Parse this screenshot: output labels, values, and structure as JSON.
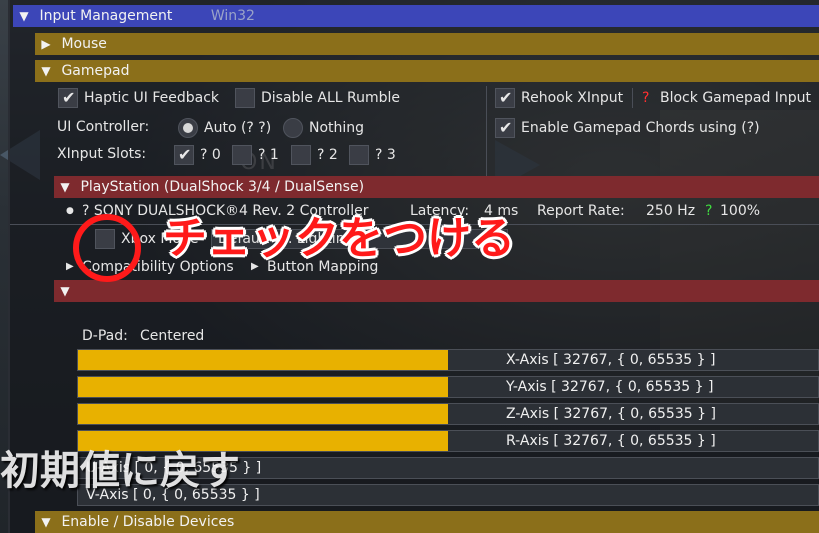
{
  "colors": {
    "section_blue": "#3c46b8",
    "section_gold": "#8b6f1a",
    "section_red": "#7e2a2e",
    "axis_fill": "#e8b100",
    "annotation": "#ff1a1a",
    "green": "#3fdc3f",
    "red": "#ff3030"
  },
  "header": {
    "title": "Input Management",
    "platform": "Win32"
  },
  "sections": {
    "mouse": "Mouse",
    "gamepad": "Gamepad",
    "enable_devices": "Enable / Disable Devices"
  },
  "gamepad": {
    "haptic": {
      "label": "Haptic UI Feedback",
      "checked": true
    },
    "disable_rumble": {
      "label": "Disable ALL Rumble",
      "checked": false
    },
    "rehook": {
      "label": "Rehook XInput",
      "checked": true
    },
    "block_mark": "?",
    "block": {
      "label": "Block Gamepad Input"
    },
    "ui_controller_label": "UI Controller:",
    "auto_label": "Auto (? ?)",
    "nothing_label": "Nothing",
    "chords": {
      "label": "Enable Gamepad Chords using  (?)",
      "checked": true
    },
    "xinput_label": "XInput Slots:",
    "slots": [
      {
        "label": "? 0",
        "checked": true
      },
      {
        "label": "? 1",
        "checked": false
      },
      {
        "label": "? 2",
        "checked": false
      },
      {
        "label": "? 3",
        "checked": false
      }
    ]
  },
  "playstation": {
    "title": "PlayStation  (DualShock 3/4 / DualSense)",
    "controller": "? SONY DUALSHOCK®4 Rev. 2 Controller",
    "latency_label": "Latency:",
    "latency_value": "4 ms",
    "rate_label": "Report Rate:",
    "rate_value": "250 Hz",
    "battery_mark": "?",
    "battery": "100%",
    "xbox_label": "Xbox Mode",
    "lighting_value": "Default (... Lighting",
    "compat": "Compatibility Options",
    "mapping": "Button Mapping"
  },
  "dpad": {
    "label": "D-Pad:",
    "value": "Centered"
  },
  "axes": [
    {
      "label": "X-Axis [ 32767, { 0, 65535 } ]",
      "fill": 0.5
    },
    {
      "label": "Y-Axis [ 32767, { 0, 65535 } ]",
      "fill": 0.5
    },
    {
      "label": "Z-Axis [ 32767, { 0, 65535 } ]",
      "fill": 0.5
    },
    {
      "label": "R-Axis [ 32767, { 0, 65535 } ]",
      "fill": 0.5
    },
    {
      "label": "U-Axis [ 0, { 0, 65535 } ]",
      "fill": 0
    },
    {
      "label": "V-Axis [ 0, { 0, 65535 } ]",
      "fill": 0
    }
  ],
  "annotation": {
    "text": "チェックをつける"
  },
  "overlay": {
    "text": "初期値に戻す"
  },
  "bg_sign": "ON"
}
